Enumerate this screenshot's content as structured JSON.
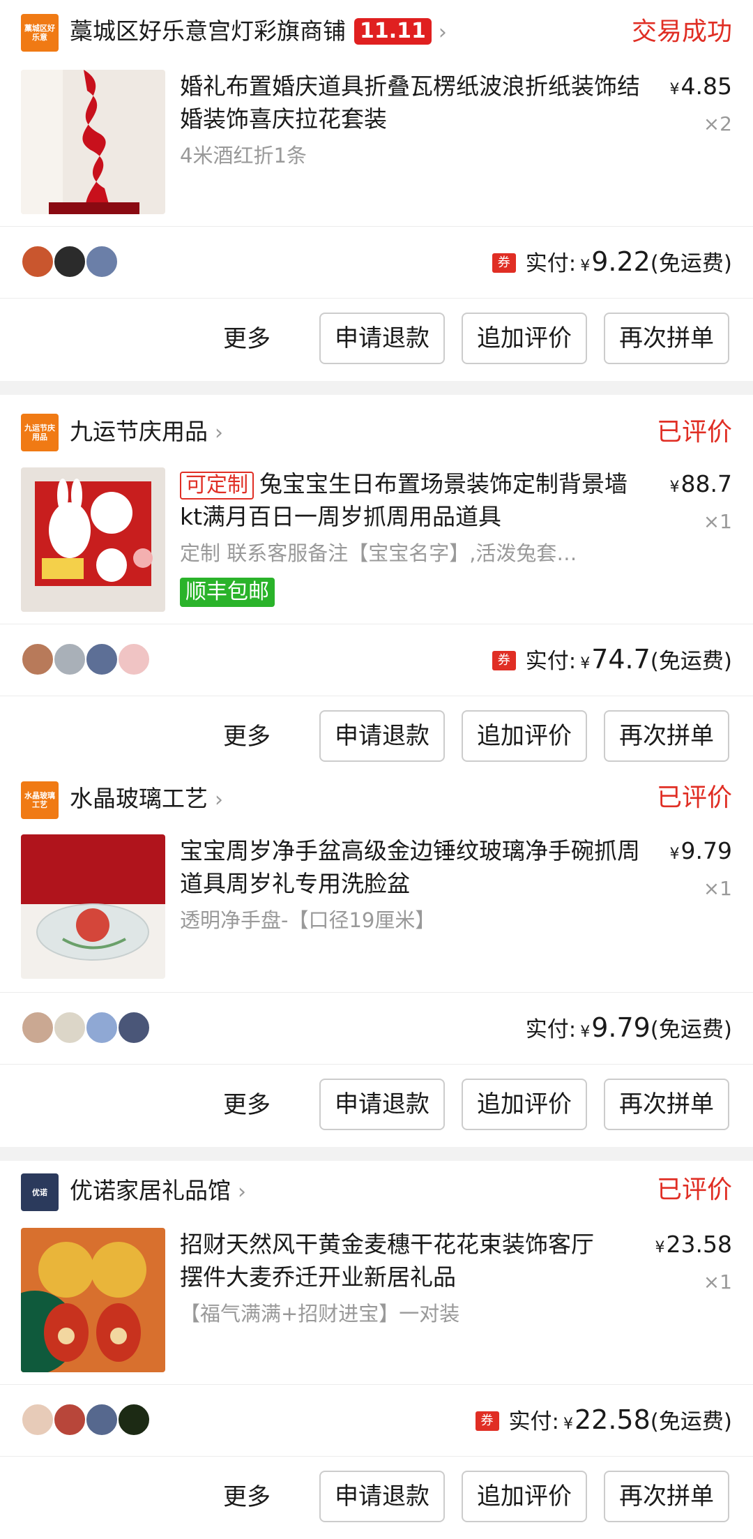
{
  "orders": [
    {
      "shop": "藁城区好乐意宫灯彩旗商铺",
      "logo_text": "藁城区好乐意",
      "logo_color": "#f07a14",
      "badge": "11.11",
      "status": "交易成功",
      "title": "婚礼布置婚庆道具折叠瓦楞纸波浪折纸装饰结婚装饰喜庆拉花套装",
      "spec": "4米酒红折1条",
      "price": "4.85",
      "qty": "×2",
      "pay_label": "实付:",
      "pay_amount": "9.22",
      "pay_note": "(免运费)"
    },
    {
      "shop": "九运节庆用品",
      "logo_text": "九运节庆用品",
      "logo_color": "#f07a14",
      "status": "已评价",
      "tag": "可定制",
      "title": "兔宝宝生日布置场景装饰定制背景墙kt满月百日一周岁抓周用品道具",
      "spec": "定制 联系客服备注【宝宝名字】,活泼兔套…",
      "sf": "顺丰包邮",
      "price": "88.7",
      "qty": "×1",
      "pay_label": "实付:",
      "pay_amount": "74.7",
      "pay_note": "(免运费)"
    },
    {
      "shop": "水晶玻璃工艺",
      "logo_text": "水晶玻璃工艺",
      "logo_color": "#f07a14",
      "status": "已评价",
      "title": "宝宝周岁净手盆高级金边锤纹玻璃净手碗抓周道具周岁礼专用洗脸盆",
      "spec": "透明净手盘-【口径19厘米】",
      "price": "9.79",
      "qty": "×1",
      "pay_label": "实付:",
      "pay_amount": "9.79",
      "pay_note": "(免运费)"
    },
    {
      "shop": "优诺家居礼品馆",
      "logo_text": "优诺",
      "logo_color": "#2b3a5c",
      "status": "已评价",
      "title": "招财天然风干黄金麦穗干花花束装饰客厅摆件大麦乔迁开业新居礼品",
      "spec": "【福气满满+招财进宝】一对装",
      "price": "23.58",
      "qty": "×1",
      "pay_label": "实付:",
      "pay_amount": "22.58",
      "pay_note": "(免运费)"
    }
  ],
  "buttons": {
    "more": "更多",
    "refund": "申请退款",
    "review": "追加评价",
    "rebuy": "再次拼单"
  },
  "currency": "¥",
  "coupon": "券",
  "chevron": "›"
}
